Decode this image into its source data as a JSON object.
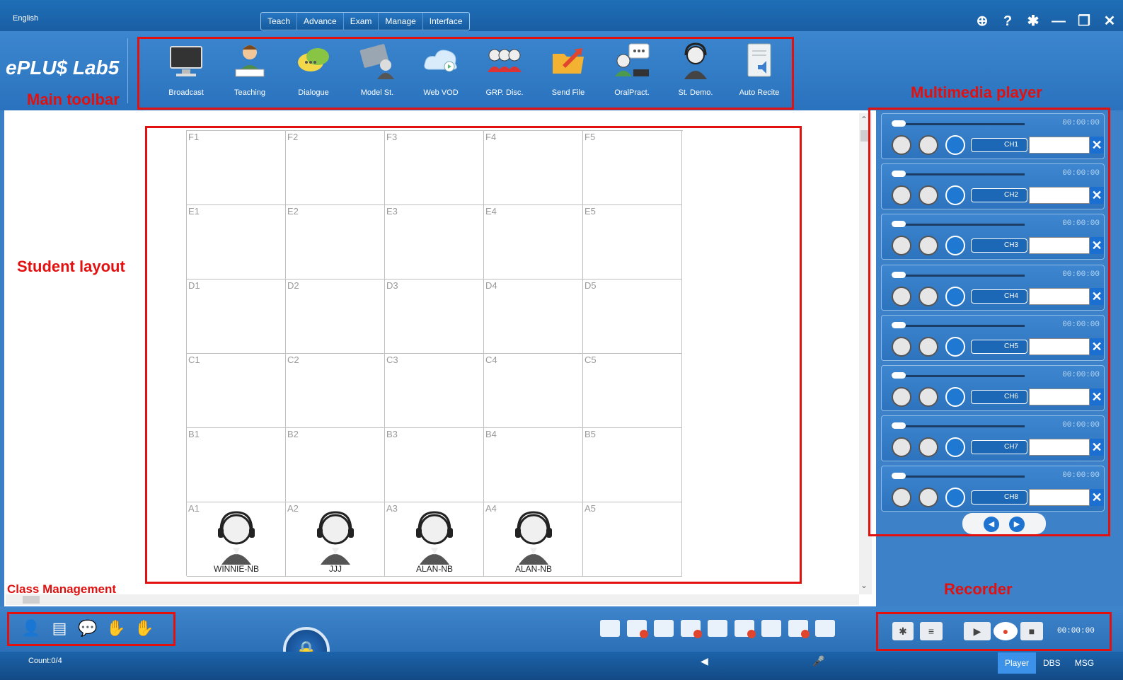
{
  "window": {
    "language": "English",
    "controls": [
      "globe-icon",
      "help-icon",
      "gear-icon",
      "minimize-icon",
      "restore-icon",
      "close-icon"
    ]
  },
  "menu": [
    "Teach",
    "Advance",
    "Exam",
    "Manage",
    "Interface"
  ],
  "logo": "ePLU$ Lab5",
  "annotations": {
    "main_toolbar": "Main toolbar",
    "multimedia_player": "Multimedia player",
    "student_layout": "Student layout",
    "class_management": "Class Management",
    "recorder": "Recorder"
  },
  "toolbar": [
    {
      "label": "Broadcast",
      "icon": "monitor-icon"
    },
    {
      "label": "Teaching",
      "icon": "teacher-icon"
    },
    {
      "label": "Dialogue",
      "icon": "chat-bubbles-icon"
    },
    {
      "label": "Model St.",
      "icon": "model-student-icon"
    },
    {
      "label": "Web VOD",
      "icon": "cloud-video-icon"
    },
    {
      "label": "GRP. Disc.",
      "icon": "group-icon"
    },
    {
      "label": "Send File",
      "icon": "folder-send-icon"
    },
    {
      "label": "OralPract.",
      "icon": "oral-practice-icon"
    },
    {
      "label": "St. Demo.",
      "icon": "student-headset-icon"
    },
    {
      "label": "Auto Recite",
      "icon": "document-audio-icon"
    }
  ],
  "seats": {
    "rows": [
      [
        "F1",
        "F2",
        "F3",
        "F4",
        "F5"
      ],
      [
        "E1",
        "E2",
        "E3",
        "E4",
        "E5"
      ],
      [
        "D1",
        "D2",
        "D3",
        "D4",
        "D5"
      ],
      [
        "C1",
        "C2",
        "C3",
        "C4",
        "C5"
      ],
      [
        "B1",
        "B2",
        "B3",
        "B4",
        "B5"
      ],
      [
        "A1",
        "A2",
        "A3",
        "A4",
        "A5"
      ]
    ],
    "students": {
      "A1": "WINNIE-NB",
      "A2": "JJJ",
      "A3": "ALAN-NB",
      "A4": "ALAN-NB"
    }
  },
  "player": {
    "channels": [
      {
        "label": "CH1",
        "time": "00:00:00"
      },
      {
        "label": "CH2",
        "time": "00:00:00"
      },
      {
        "label": "CH3",
        "time": "00:00:00"
      },
      {
        "label": "CH4",
        "time": "00:00:00"
      },
      {
        "label": "CH5",
        "time": "00:00:00"
      },
      {
        "label": "CH6",
        "time": "00:00:00"
      },
      {
        "label": "CH7",
        "time": "00:00:00"
      },
      {
        "label": "CH8",
        "time": "00:00:00"
      }
    ]
  },
  "recorder": {
    "time": "00:00:00"
  },
  "status": {
    "count": "Count:0/4"
  },
  "tabs": [
    "Player",
    "DBS",
    "MSG"
  ],
  "colors": {
    "accent": "#2a72bd",
    "annotation": "#e31010",
    "active_tab": "#3b92e8"
  }
}
